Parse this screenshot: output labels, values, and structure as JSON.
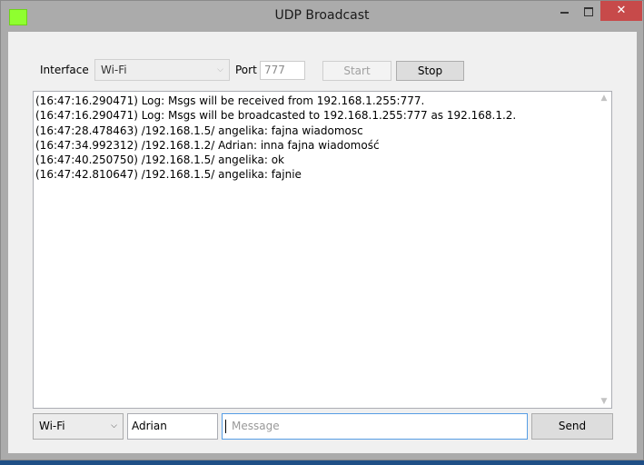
{
  "window": {
    "title": "UDP Broadcast",
    "icon": "app-icon",
    "icon_color": "#8fff2f",
    "controls": {
      "minimize": "minimize-icon",
      "maximize": "maximize-icon",
      "close": "✕"
    }
  },
  "toolbar": {
    "interface_label": "Interface",
    "interface_value": "Wi-Fi",
    "port_label": "Port",
    "port_value": "777",
    "start_label": "Start",
    "stop_label": "Stop"
  },
  "log": {
    "lines": [
      "(16:47:16.290471) Log: Msgs will be received from 192.168.1.255:777.",
      "(16:47:16.290471) Log: Msgs will be broadcasted to 192.168.1.255:777 as 192.168.1.2.",
      "(16:47:28.478463) /192.168.1.5/ angelika: fajna wiadomosc",
      "(16:47:34.992312) /192.168.1.2/ Adrian: inna fajna wiadomość",
      "(16:47:40.250750) /192.168.1.5/ angelika: ok",
      "(16:47:42.810647) /192.168.1.5/ angelika: fajnie"
    ]
  },
  "footer": {
    "interface_value": "Wi-Fi",
    "name_value": "Adrian",
    "message_value": "",
    "message_placeholder": "Message",
    "send_label": "Send"
  }
}
